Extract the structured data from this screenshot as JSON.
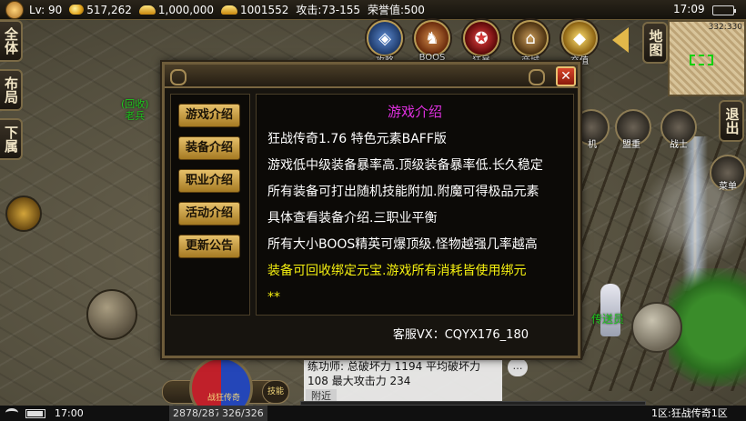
{
  "top_bar": {
    "level": "Lv: 90",
    "gold": "517,262",
    "ingot": "1,000,000",
    "bound_ingot": "1001552",
    "attack": "攻击:73-155",
    "honor": "荣誉值:500",
    "time": "17:09"
  },
  "top_icons": [
    {
      "label": "攻略",
      "icon": "scroll-icon",
      "color": "#3a6aa8"
    },
    {
      "label": "BOOS",
      "icon": "boss-icon",
      "color": "#a85a28"
    },
    {
      "label": "狂暴",
      "icon": "rage-icon",
      "color": "#b02020"
    },
    {
      "label": "商城",
      "icon": "shop-icon",
      "color": "#8a6a30"
    },
    {
      "label": "充值",
      "icon": "recharge-icon",
      "color": "#c89a20"
    }
  ],
  "left_buttons": [
    "全体",
    "布局",
    "下属"
  ],
  "right_buttons": [
    "地图",
    "退出"
  ],
  "minimap": {
    "coords": "332:330"
  },
  "npcs": {
    "recycle": "(回收)\n老兵",
    "teleport": "传送员"
  },
  "game_icons": [
    {
      "label": "机"
    },
    {
      "label": "盟重"
    },
    {
      "label": "战士"
    },
    {
      "label": "菜单"
    }
  ],
  "dialog": {
    "title": "游戏介绍",
    "close_label": "✕",
    "nav": [
      "游戏介绍",
      "装备介绍",
      "职业介绍",
      "活动介绍",
      "更新公告"
    ],
    "content_lines": [
      {
        "text": "狂战传奇1.76 特色元素BAFF版",
        "color": "white"
      },
      {
        "text": "游戏低中级装备暴率高.顶级装备暴率低.长久稳定",
        "color": "white"
      },
      {
        "text": "所有装备可打出随机技能附加.附魔可得极品元素",
        "color": "white"
      },
      {
        "text": "具体查看装备介绍.三职业平衡",
        "color": "white"
      },
      {
        "text": "所有大小BOOS精英可爆顶级.怪物越强几率越高",
        "color": "white"
      },
      {
        "text": "装备可回收绑定元宝.游戏所有消耗皆使用绑元",
        "color": "yellow"
      },
      {
        "text": "**",
        "color": "yellow"
      }
    ],
    "footer": "客服VX：CQYX176_180"
  },
  "chat": {
    "message": "练功师: 总破坏力 1194 平均破坏力 108 最大攻击力 234",
    "tab": "附近"
  },
  "orb": {
    "name": "战狂传奇",
    "button": "技能"
  },
  "bottom_bar": {
    "time": "17:00",
    "hp": "2878/2878",
    "mp": "326/326",
    "server": "1区:狂战传奇1区"
  },
  "colors": {
    "title_magenta": "#e030e0",
    "highlight_yellow": "#f5f010",
    "npc_green": "#1ec81e",
    "nav_gold": "#e6c06a"
  }
}
